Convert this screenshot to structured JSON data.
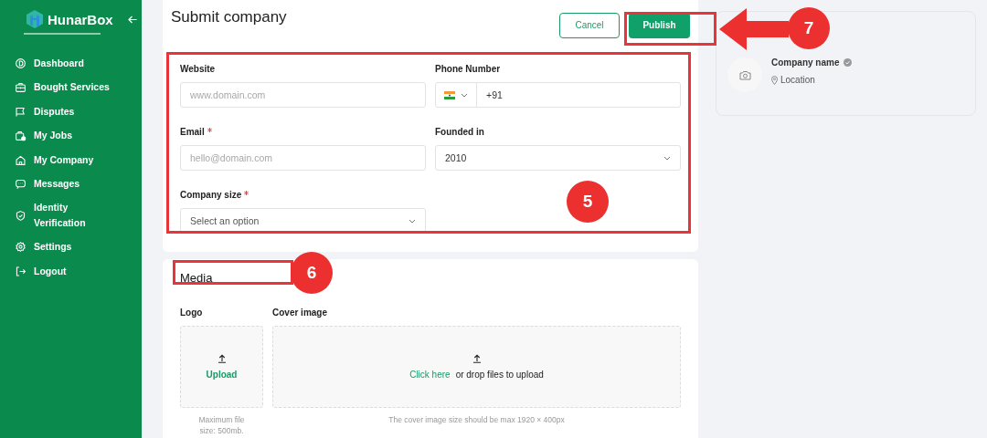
{
  "sidebar": {
    "brand": "HunarBox",
    "items": [
      {
        "label": "Dashboard",
        "selected": false
      },
      {
        "label": "Bought Services",
        "selected": false
      },
      {
        "label": "Disputes",
        "selected": false
      },
      {
        "label": "My Jobs",
        "selected": false
      },
      {
        "label": "My Company",
        "selected": false
      },
      {
        "label": "Messages",
        "selected": false
      },
      {
        "label": "Identity Verification",
        "selected": false
      },
      {
        "label": "Settings",
        "selected": false
      },
      {
        "label": "Logout",
        "selected": false
      }
    ]
  },
  "header": {
    "title": "Submit company",
    "buttons": [
      {
        "label": "Cancel",
        "kind": "outline"
      },
      {
        "label": "Publish",
        "kind": "primary"
      }
    ]
  },
  "form": {
    "fields": [
      {
        "label": "Website",
        "required": false,
        "kind": "input",
        "placeholder": "www.domain.com"
      },
      {
        "label": "Phone Number",
        "required": false,
        "kind": "phone",
        "value": "+91"
      },
      {
        "label": "Email",
        "required": true,
        "kind": "input",
        "placeholder": "hello@domain.com"
      },
      {
        "label": "Founded in",
        "required": false,
        "kind": "select",
        "value": "2010"
      },
      {
        "label": "Company size",
        "required": true,
        "kind": "select",
        "placeholder": "Select an option"
      }
    ]
  },
  "media": {
    "title": "Media",
    "logo": {
      "label": "Logo",
      "action": "Upload",
      "hint": "Maximum file size: 500mb."
    },
    "cover": {
      "label": "Cover image",
      "link": "Click here",
      "text": "or drop files to upload",
      "hint": "The cover image size should be max 1920 × 400px"
    }
  },
  "preview": {
    "company_name": "Company name",
    "location": "Location"
  },
  "annotations": [
    {
      "number": "7"
    },
    {
      "number": "5"
    },
    {
      "number": "6"
    }
  ]
}
